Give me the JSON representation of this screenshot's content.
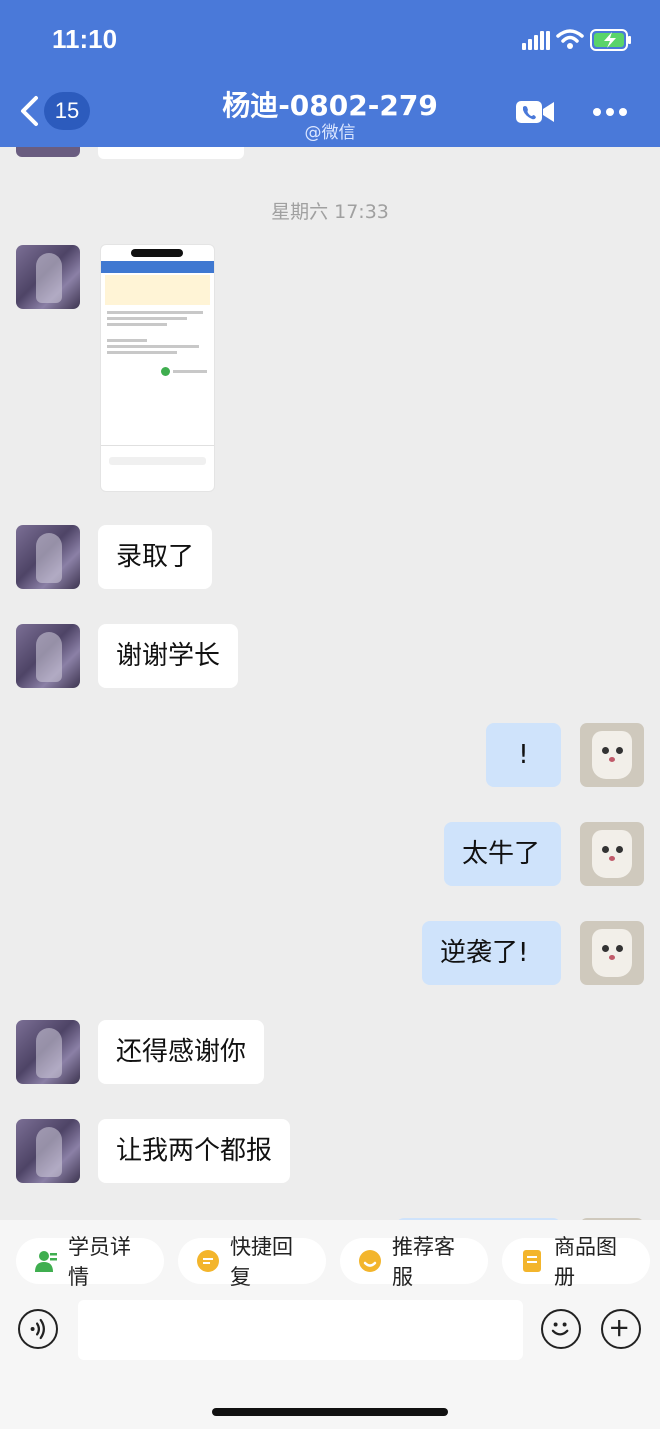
{
  "status_bar": {
    "time": "11:10"
  },
  "header": {
    "back_badge": "15",
    "title": "杨迪-0802-279",
    "subtitle": "@微信"
  },
  "chat": {
    "timestamp": "星期六 17:33",
    "messages": [
      {
        "side": "in",
        "type": "image"
      },
      {
        "side": "in",
        "text": "录取了"
      },
      {
        "side": "in",
        "text": "谢谢学长"
      },
      {
        "side": "out",
        "text": "!"
      },
      {
        "side": "out",
        "text": "太牛了"
      },
      {
        "side": "out",
        "text": "逆袭了!"
      },
      {
        "side": "in",
        "text": "还得感谢你"
      },
      {
        "side": "in",
        "text": "让我两个都报"
      }
    ]
  },
  "quick_actions": [
    {
      "label": "学员详情",
      "icon": "student-detail-icon",
      "color": "#3fae4f"
    },
    {
      "label": "快捷回复",
      "icon": "quick-reply-icon",
      "color": "#f3b52c"
    },
    {
      "label": "推荐客服",
      "icon": "recommend-service-icon",
      "color": "#f3b52c"
    },
    {
      "label": "商品图册",
      "icon": "product-album-icon",
      "color": "#f3b52c"
    }
  ],
  "colors": {
    "header_bg": "#4a79d9",
    "outgoing_bubble": "#cfe3fb",
    "incoming_bubble": "#ffffff",
    "chat_bg": "#ededed"
  }
}
